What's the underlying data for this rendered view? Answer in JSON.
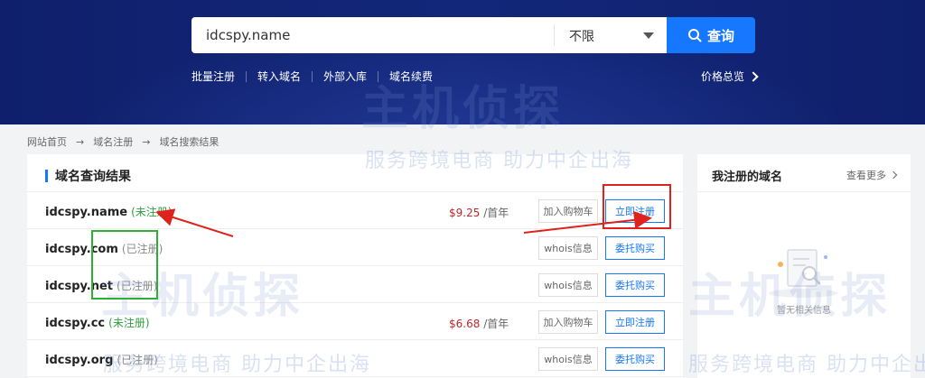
{
  "search": {
    "value": "idcspy.name",
    "filter_value": "不限",
    "button_label": "查询"
  },
  "quick_links": [
    "批量注册",
    "转入域名",
    "外部入库",
    "域名续费"
  ],
  "price_overview": "价格总览",
  "breadcrumb": [
    "网站首页",
    "域名注册",
    "域名搜索结果"
  ],
  "results": {
    "title": "域名查询结果",
    "rows": [
      {
        "domain": "idcspy.name",
        "status": "(未注册)",
        "status_type": "free",
        "price": "$9.25",
        "unit": "/首年",
        "left_btn": "加入购物车",
        "right_btn": "立即注册"
      },
      {
        "domain": "idcspy.com",
        "status": "(已注册)",
        "status_type": "taken",
        "price": "",
        "unit": "",
        "left_btn": "whois信息",
        "right_btn": "委托购买"
      },
      {
        "domain": "idcspy.net",
        "status": "(已注册)",
        "status_type": "taken",
        "price": "",
        "unit": "",
        "left_btn": "whois信息",
        "right_btn": "委托购买"
      },
      {
        "domain": "idcspy.cc",
        "status": "(未注册)",
        "status_type": "free",
        "price": "$6.68",
        "unit": "/首年",
        "left_btn": "加入购物车",
        "right_btn": "立即注册"
      },
      {
        "domain": "idcspy.org",
        "status": "(已注册)",
        "status_type": "taken",
        "price": "",
        "unit": "",
        "left_btn": "whois信息",
        "right_btn": "委托购买"
      }
    ]
  },
  "side": {
    "title": "我注册的域名",
    "more": "查看更多",
    "empty": "暂无相关信息"
  },
  "watermark": {
    "brand": "主机侦探",
    "slogan": "服务跨境电商 助力中企出海"
  },
  "colors": {
    "header_bg": "#13277a",
    "accent": "#1677ff",
    "price": "#c0262d",
    "free": "#2e9e3e",
    "annotation_red": "#e0221c",
    "annotation_green": "#2fae35"
  }
}
